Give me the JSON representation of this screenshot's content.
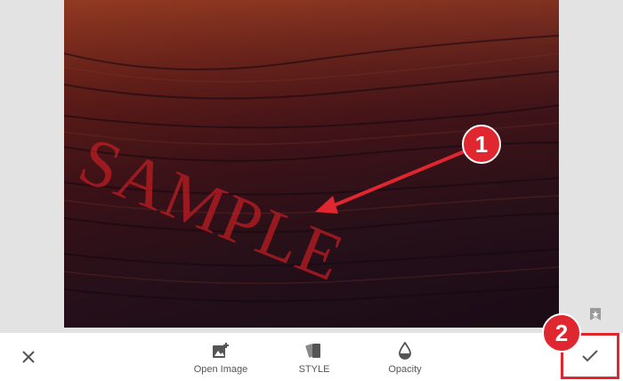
{
  "editor": {
    "watermark_text": "SAMPLE"
  },
  "toolbar": {
    "tools": [
      {
        "label": "Open Image",
        "icon": "add-photo-icon"
      },
      {
        "label": "STYLE",
        "icon": "style-cards-icon"
      },
      {
        "label": "Opacity",
        "icon": "opacity-drop-icon"
      }
    ],
    "close_icon": "close-icon",
    "confirm_icon": "checkmark-icon"
  },
  "annotations": {
    "callout_1": "1",
    "callout_2": "2",
    "accent_color": "#e0262f"
  }
}
